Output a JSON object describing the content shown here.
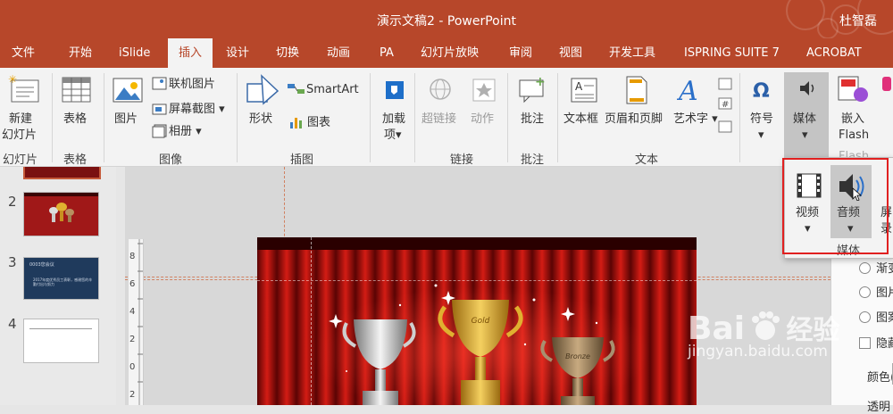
{
  "window": {
    "title": "演示文稿2 - PowerPoint",
    "user": "杜智磊"
  },
  "tabs": [
    "文件",
    "开始",
    "iSlide",
    "插入",
    "设计",
    "切换",
    "动画",
    "PA",
    "幻灯片放映",
    "审阅",
    "视图",
    "开发工具",
    "ISPRING SUITE 7",
    "ACROBAT"
  ],
  "active_tab": "插入",
  "ribbon": {
    "new_slide": [
      "新建",
      "幻灯片"
    ],
    "new_slide_group": "幻灯片",
    "table": "表格",
    "table_group": "表格",
    "picture": "图片",
    "online_pictures": "联机图片",
    "screenshot": "屏幕截图",
    "album": "相册",
    "images_group": "图像",
    "shapes": "形状",
    "smartart": "SmartArt",
    "chart": "图表",
    "illustrations_group": "插图",
    "addins": [
      "加载",
      "项"
    ],
    "hyperlink": "超链接",
    "action": "动作",
    "links_group": "链接",
    "comment": "批注",
    "comments_group": "批注",
    "textbox": "文本框",
    "header_footer": "页眉和页脚",
    "wordart": "艺术字",
    "text_group": "文本",
    "symbol": "符号",
    "media": "媒体",
    "embed_flash": [
      "嵌入",
      "Flash"
    ],
    "flash_group": "Flash"
  },
  "media_popup": {
    "video": "视频",
    "audio": "音频",
    "screen_record": [
      "屏",
      "录"
    ],
    "group": "媒体"
  },
  "slides": [
    {
      "num": "2"
    },
    {
      "num": "3",
      "caption": "0003您会议",
      "text": "2017年度优秀员工表彰，感谢您的辛勤付出与努力"
    },
    {
      "num": "4"
    }
  ],
  "ruler_ticks": [
    "8",
    "6",
    "4",
    "2",
    "0",
    "2"
  ],
  "trophy_texts": [
    "Bronze",
    "Gold"
  ],
  "format_pane": {
    "options": [
      "渐变",
      "图片",
      "图案",
      "隐藏"
    ],
    "color_label": "颜色(",
    "transparency_label": "透明"
  },
  "watermark": {
    "brand": "Bai",
    "brand2": "经验",
    "url": "jingyan.baidu.com"
  },
  "colors": {
    "accent": "#b7472a",
    "highlight": "#e02020",
    "ribbon_bg": "#f3f3f3"
  }
}
